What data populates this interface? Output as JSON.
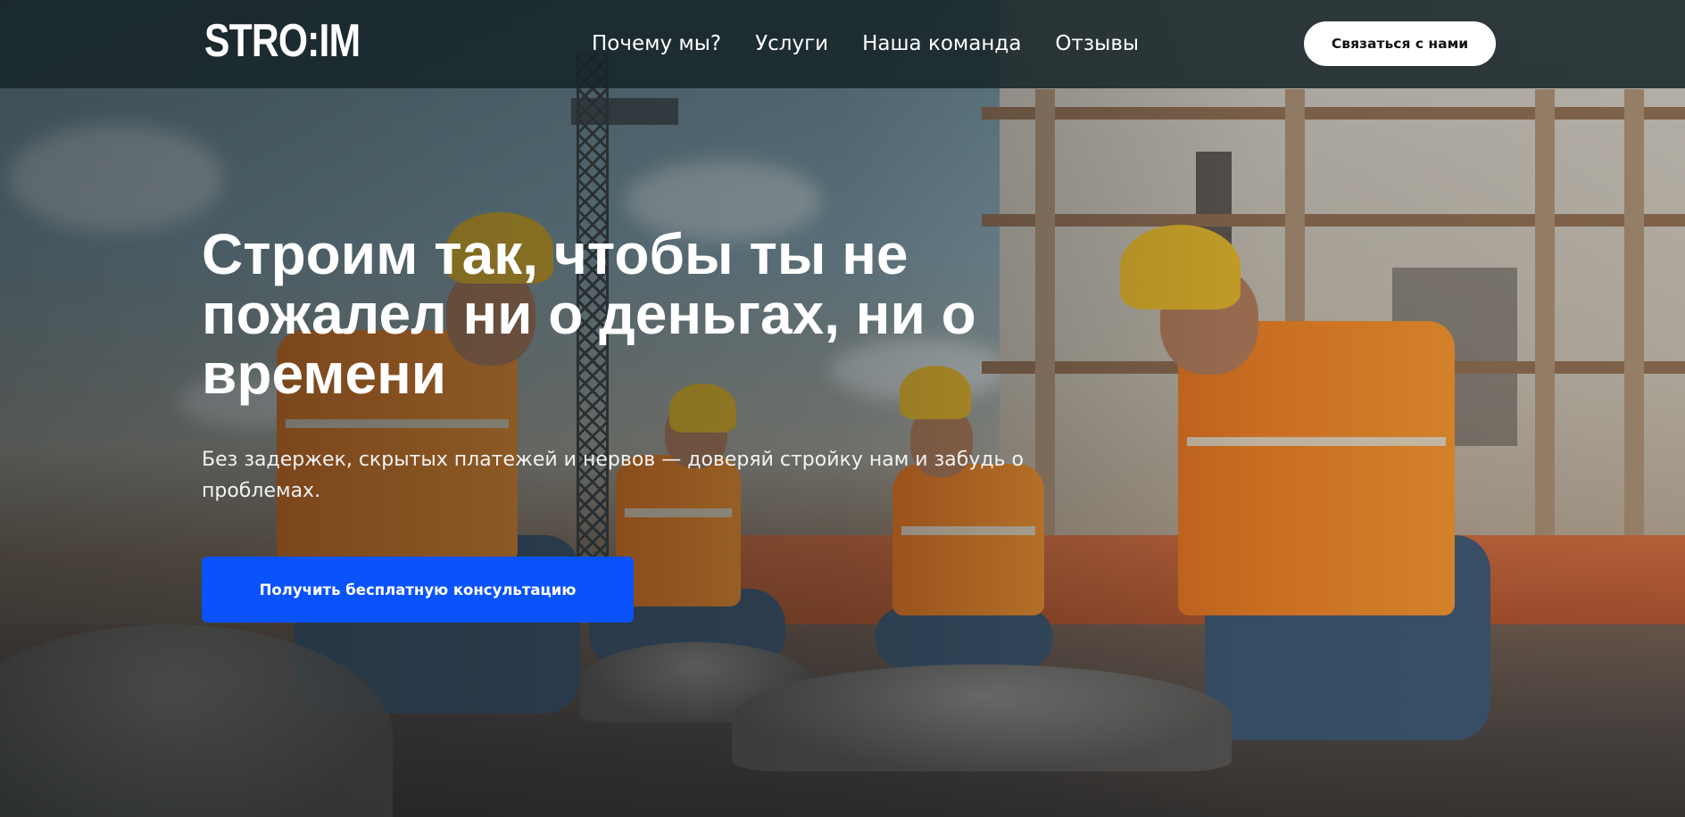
{
  "header": {
    "logo_text": "STRO:IM",
    "nav": [
      {
        "label": "Почему мы?"
      },
      {
        "label": "Услуги"
      },
      {
        "label": "Наша команда"
      },
      {
        "label": "Отзывы"
      }
    ],
    "contact_button": "Связаться с нами"
  },
  "hero": {
    "title": "Строим так, чтобы ты не пожалел ни о деньгах, ни о времени",
    "subtitle": "Без задержек, скрытых платежей и нервов — доверяй стройку нам и забудь о проблемах.",
    "cta_button": "Получить бесплатную консультацию",
    "background_image": "construction-workers-photo"
  },
  "colors": {
    "header_bg": "#162428",
    "cta": "#0a53fb",
    "contact_button_bg": "#ffffff"
  }
}
